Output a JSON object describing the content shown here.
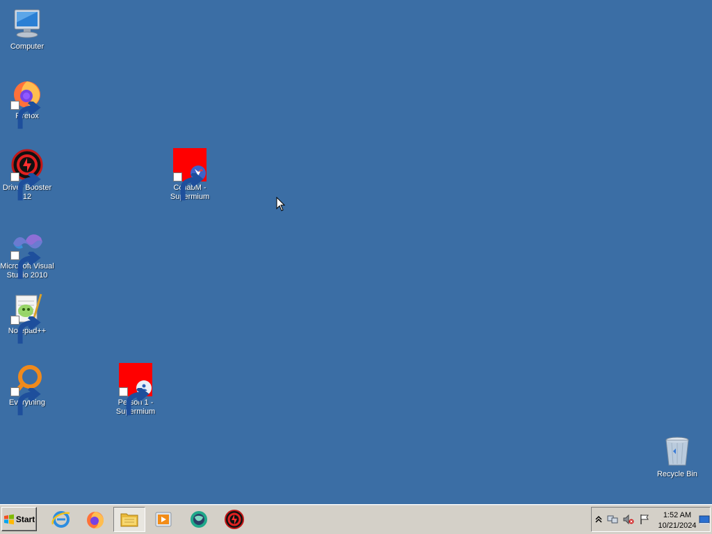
{
  "desktop": {
    "background": "#3b6ea5",
    "icons": [
      {
        "label": "Computer",
        "icon": "computer-icon",
        "shortcut": false
      },
      {
        "label": "Firefox",
        "icon": "firefox-icon",
        "shortcut": true
      },
      {
        "label": "Driver Booster 12",
        "icon": "driver-booster-icon",
        "shortcut": true
      },
      {
        "label": "CollabM - Supermium",
        "icon": "collabm-supermium-icon",
        "shortcut": true
      },
      {
        "label": "Microsoft Visual Studio 2010",
        "icon": "visual-studio-icon",
        "shortcut": true
      },
      {
        "label": "Notepad++",
        "icon": "notepadpp-icon",
        "shortcut": true
      },
      {
        "label": "Everything",
        "icon": "everything-icon",
        "shortcut": true
      },
      {
        "label": "Person 1 - Supermium",
        "icon": "person-supermium-icon",
        "shortcut": true
      },
      {
        "label": "Recycle Bin",
        "icon": "recycle-bin-icon",
        "shortcut": false
      }
    ]
  },
  "taskbar": {
    "start_label": "Start",
    "pinned": [
      {
        "name": "internet-explorer-icon",
        "active": false
      },
      {
        "name": "firefox-icon",
        "active": false
      },
      {
        "name": "file-explorer-icon",
        "active": true
      },
      {
        "name": "media-player-icon",
        "active": false
      },
      {
        "name": "chat-app-icon",
        "active": false
      },
      {
        "name": "driver-booster-icon",
        "active": false
      }
    ],
    "tray": {
      "icons": [
        "show-hidden-icons-chevron",
        "network-icon",
        "volume-muted-icon",
        "action-center-flag-icon",
        "show-desktop-icon"
      ],
      "time": "1:52 AM",
      "date": "10/21/2024"
    }
  }
}
